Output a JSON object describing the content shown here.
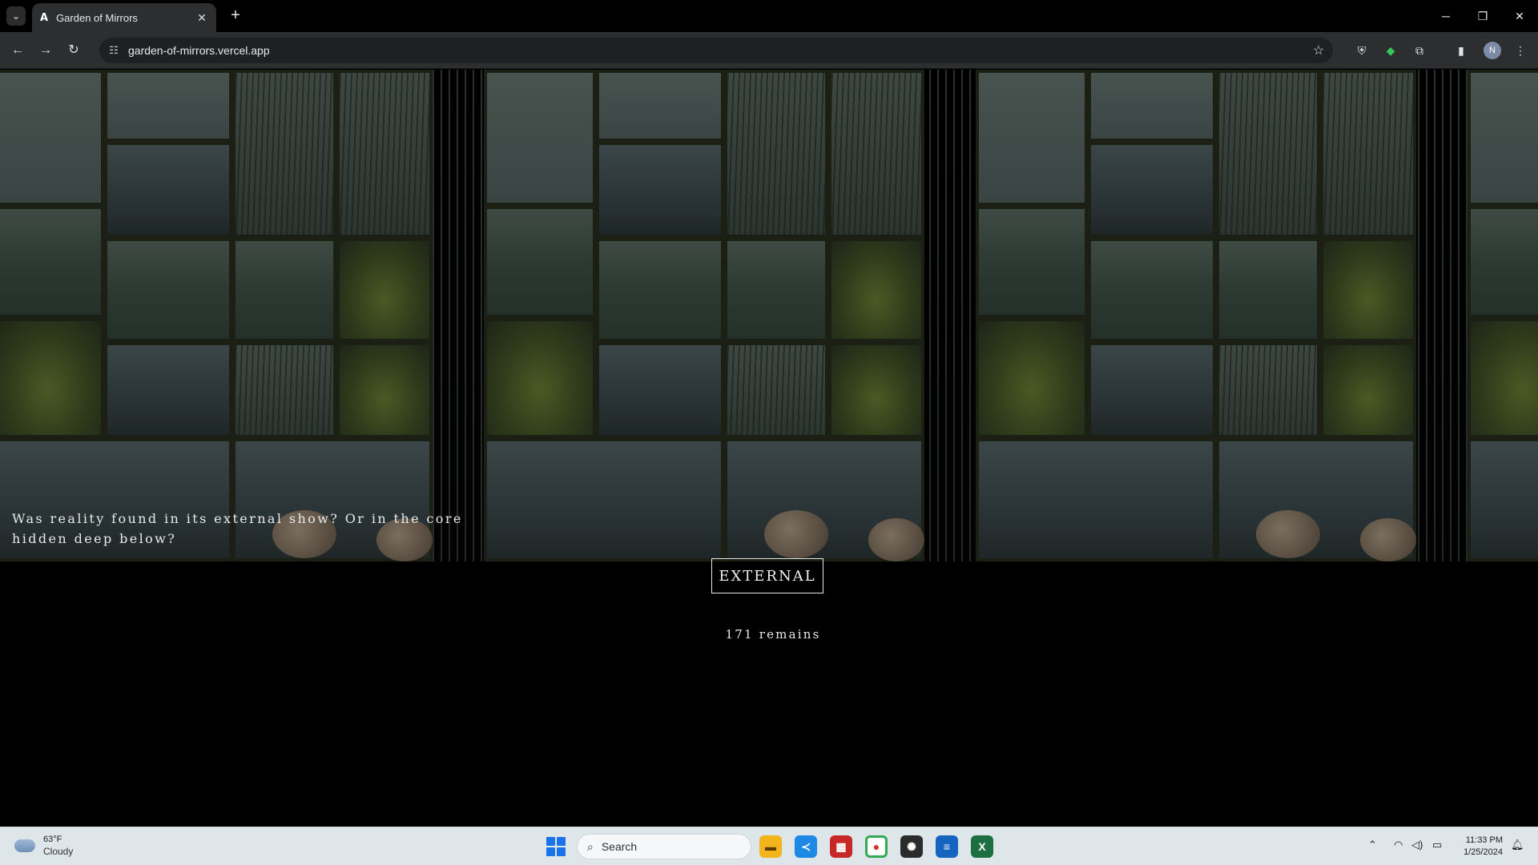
{
  "browser": {
    "tab_title": "Garden of Mirrors",
    "tab_favicon": "A",
    "url": "garden-of-mirrors.vercel.app",
    "profile_initial": "N"
  },
  "page": {
    "question": "Was reality found in its external show? Or in the core hidden deep below?",
    "choice_label": "EXTERNAL",
    "remains_text": "171 remains"
  },
  "taskbar": {
    "weather_temp": "63°F",
    "weather_condition": "Cloudy",
    "search_placeholder": "Search",
    "time": "11:33 PM",
    "date": "1/25/2024"
  }
}
